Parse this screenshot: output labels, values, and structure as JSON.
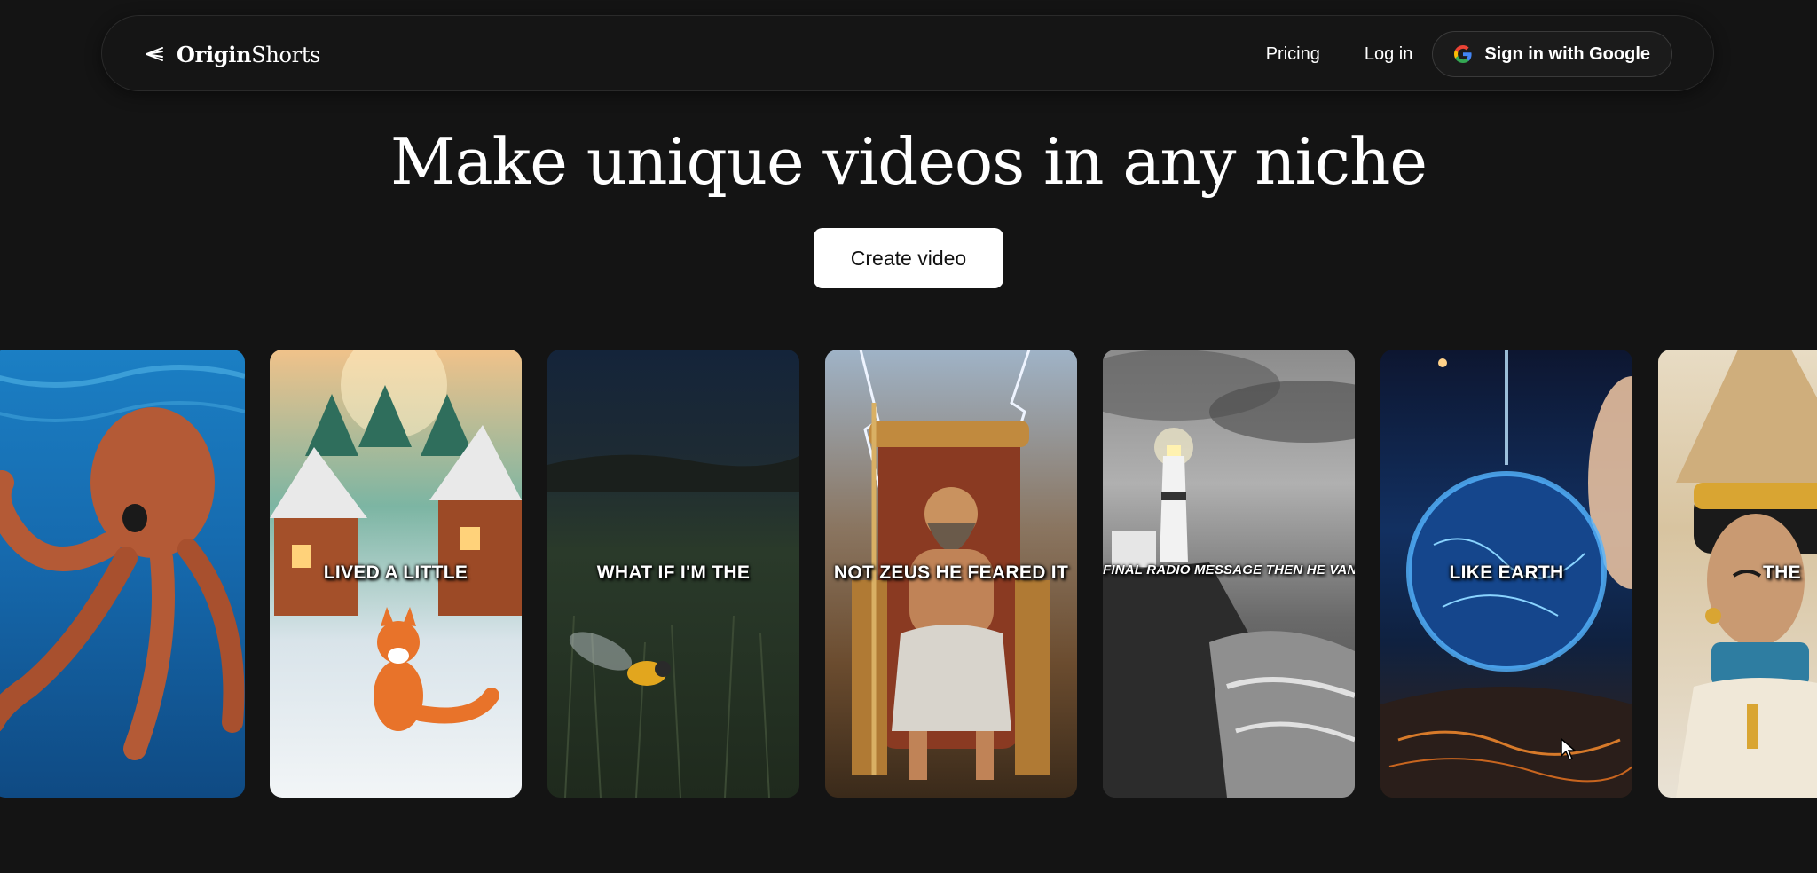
{
  "nav": {
    "logo_bold": "Origin",
    "logo_light": "Shorts",
    "pricing": "Pricing",
    "login": "Log in",
    "google_signin": "Sign in with Google"
  },
  "hero": {
    "title": "Make unique videos in any niche",
    "cta": "Create video"
  },
  "cards": [
    {
      "caption": ""
    },
    {
      "caption": "LIVED A LITTLE"
    },
    {
      "caption": "WHAT IF I'M THE"
    },
    {
      "caption": "NOT ZEUS HE FEARED IT"
    },
    {
      "caption": "FINAL RADIO MESSAGE THEN HE VANISHED"
    },
    {
      "caption": "LIKE EARTH"
    },
    {
      "caption": "THE"
    }
  ],
  "colors": {
    "background": "#141414",
    "cta_bg": "#ffffff"
  },
  "icons": {
    "logo": "wing-arrow-icon",
    "google": "google-g-icon"
  }
}
